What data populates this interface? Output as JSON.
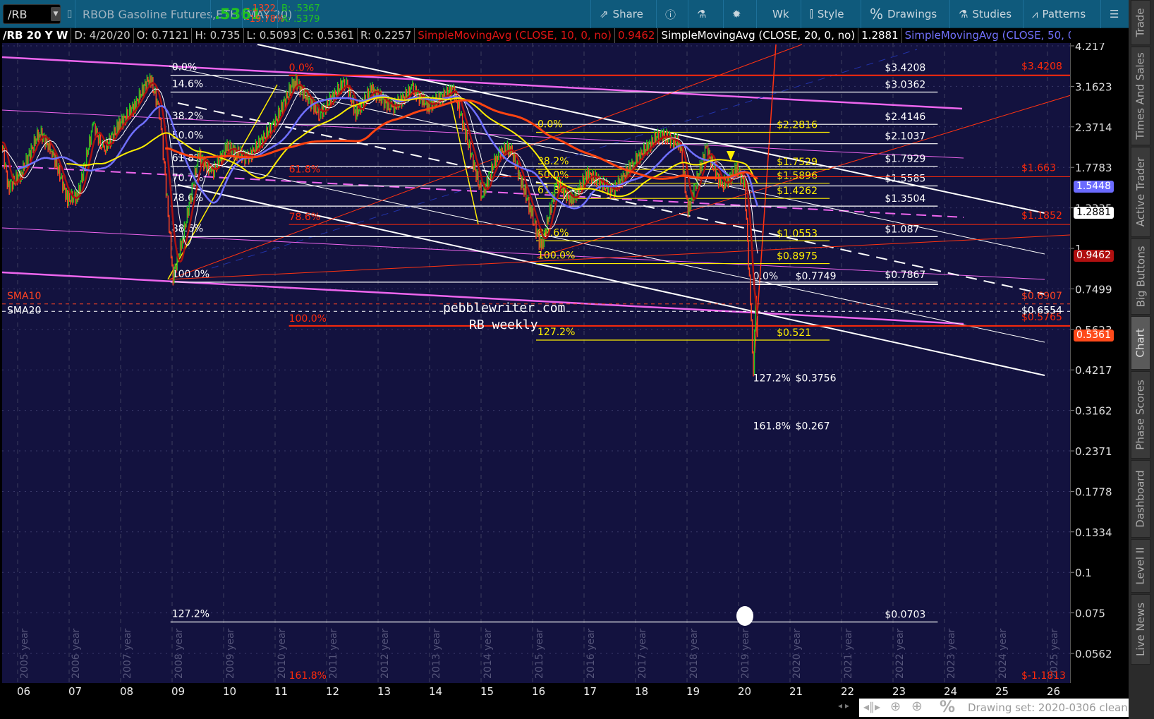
{
  "toolbar": {
    "symbol": "/RB",
    "description": "RBOB Gasoline Futures,ETH (MAY 20)",
    "last": ".5361",
    "change": "-.1322",
    "change_pct": "-19.78%",
    "bid": "B: .5367",
    "ask": "A: .5379",
    "buttons": {
      "share": "Share",
      "period": "Wk",
      "style": "Style",
      "drawings": "Drawings",
      "studies": "Studies",
      "patterns": "Patterns"
    },
    "colors": {
      "bg": "#0f5a7c",
      "up": "#22c322",
      "down": "#ff4422"
    }
  },
  "infobar": {
    "symbol": "/RB 20 Y W",
    "date": "D: 4/20/20",
    "open": "O: 0.7121",
    "high": "H: 0.735",
    "low": "L: 0.5093",
    "close": "C: 0.5361",
    "range": "R: 0.2257",
    "sma10_label": "SimpleMovingAvg (CLOSE, 10, 0, no)",
    "sma10_value": "0.9462",
    "sma20_label": "SimpleMovingAvg (CLOSE, 20, 0, no)",
    "sma20_value": "1.2881",
    "sma50_label": "SimpleMovingAvg (CLOSE, 50, 0,..."
  },
  "chart_data": {
    "type": "line",
    "scale": "log",
    "y_ticks": [
      "4.217",
      "3.1623",
      "2.3714",
      "1.7783",
      "1.3335",
      "1",
      "0.7499",
      "0.5623",
      "0.4217",
      "0.3162",
      "0.2371",
      "0.1778",
      "0.1334",
      "0.1",
      "0.075",
      "0.0562"
    ],
    "x_ticks": [
      "06",
      "07",
      "08",
      "09",
      "10",
      "11",
      "12",
      "13",
      "14",
      "15",
      "16",
      "17",
      "18",
      "19",
      "20",
      "21",
      "22",
      "23",
      "24",
      "25",
      "26"
    ],
    "year_grid": [
      "2005 year",
      "2006 year",
      "2007 year",
      "2008 year",
      "2009 year",
      "2010 year",
      "2011 year",
      "2012 year",
      "2013 year",
      "2014 year",
      "2015 year",
      "2016 year",
      "2017 year",
      "2018 year",
      "2019 year",
      "2020 year",
      "2021 year",
      "2022 year",
      "2023 year",
      "2024 year",
      "2025 year"
    ],
    "price": [
      [
        2005.0,
        1.45
      ],
      [
        2005.3,
        1.75
      ],
      [
        2005.6,
        2.25
      ],
      [
        2005.75,
        1.55
      ],
      [
        2006.0,
        1.7
      ],
      [
        2006.35,
        2.3
      ],
      [
        2006.6,
        2.0
      ],
      [
        2006.9,
        1.42
      ],
      [
        2007.1,
        1.45
      ],
      [
        2007.4,
        2.4
      ],
      [
        2007.6,
        2.0
      ],
      [
        2007.9,
        2.4
      ],
      [
        2008.2,
        2.75
      ],
      [
        2008.5,
        3.4
      ],
      [
        2008.7,
        2.6
      ],
      [
        2008.95,
        0.82
      ],
      [
        2009.15,
        1.1
      ],
      [
        2009.45,
        1.95
      ],
      [
        2009.7,
        1.7
      ],
      [
        2010.0,
        2.05
      ],
      [
        2010.4,
        1.9
      ],
      [
        2010.9,
        2.4
      ],
      [
        2011.3,
        3.3
      ],
      [
        2011.8,
        2.6
      ],
      [
        2012.3,
        3.3
      ],
      [
        2012.5,
        2.6
      ],
      [
        2012.8,
        3.1
      ],
      [
        2013.2,
        2.7
      ],
      [
        2013.6,
        3.1
      ],
      [
        2013.9,
        2.75
      ],
      [
        2014.4,
        3.1
      ],
      [
        2014.95,
        1.45
      ],
      [
        2015.25,
        1.95
      ],
      [
        2015.5,
        2.05
      ],
      [
        2015.9,
        1.3
      ],
      [
        2016.1,
        1.0
      ],
      [
        2016.4,
        1.6
      ],
      [
        2016.7,
        1.4
      ],
      [
        2017.0,
        1.7
      ],
      [
        2017.5,
        1.5
      ],
      [
        2017.9,
        1.85
      ],
      [
        2018.4,
        2.25
      ],
      [
        2018.8,
        2.1
      ],
      [
        2018.95,
        1.3
      ],
      [
        2019.3,
        2.05
      ],
      [
        2019.6,
        1.55
      ],
      [
        2019.9,
        1.75
      ],
      [
        2020.05,
        1.6
      ],
      [
        2020.18,
        0.6
      ],
      [
        2020.22,
        0.42
      ],
      [
        2020.26,
        0.75
      ],
      [
        2020.3,
        0.54
      ]
    ],
    "fib_white": {
      "from": 2008.9,
      "to": 2023.8,
      "levels": [
        {
          "pct": "0.0%",
          "price": 3.4208,
          "label": "$3.4208"
        },
        {
          "pct": "14.6%",
          "price": 3.0362,
          "label": "$3.0362"
        },
        {
          "pct": "38.2%",
          "price": 2.4146,
          "label": "$2.4146"
        },
        {
          "pct": "50.0%",
          "price": 2.1037,
          "label": "$2.1037"
        },
        {
          "pct": "61.8%",
          "price": 1.7929,
          "label": "$1.7929"
        },
        {
          "pct": "70.7%",
          "price": 1.5585,
          "label": "$1.5585"
        },
        {
          "pct": "78.6%",
          "price": 1.3504,
          "label": "$1.3504"
        },
        {
          "pct": "88.6%",
          "price": 1.087,
          "label": "$1.087"
        },
        {
          "pct": "100.0%",
          "price": 0.7867,
          "label": "$0.7867"
        },
        {
          "pct": "127.2%",
          "price": 0.0703,
          "label": "$0.0703"
        }
      ]
    },
    "fib_yellow": {
      "from": 2016.0,
      "to": 2021.7,
      "levels": [
        {
          "pct": "0.0%",
          "price": 2.2816,
          "label": "$2.2816"
        },
        {
          "pct": "38.2%",
          "price": 1.7529,
          "label": "$1.7529"
        },
        {
          "pct": "50.0%",
          "price": 1.5896,
          "label": "$1.5896"
        },
        {
          "pct": "61.8%",
          "price": 1.4262,
          "label": "$1.4262"
        },
        {
          "pct": "88.6%",
          "price": 1.0553,
          "label": "$1.0553"
        },
        {
          "pct": "100.0%",
          "price": 0.8975,
          "label": "$0.8975"
        },
        {
          "pct": "127.2%",
          "price": 0.521,
          "label": "$0.521"
        }
      ]
    },
    "fib_red": {
      "from": 2011.2,
      "levels": [
        {
          "pct": "0.0%",
          "price": 3.4208,
          "label": "$3.4208"
        },
        {
          "pct": "61.8%",
          "price": 1.663,
          "label": "$1.663"
        },
        {
          "pct": "78.6%",
          "price": 1.1852,
          "label": "$1.1852"
        },
        {
          "pct": "100.0%",
          "price": 0.5765,
          "label": "$0.5765"
        },
        {
          "pct": "161.8%",
          "price": null,
          "label": "$-1.1813"
        }
      ]
    },
    "fib_small": {
      "from": 2020.2,
      "levels": [
        {
          "pct": "0.0%",
          "price": 0.7749,
          "label": "$0.7749"
        },
        {
          "pct": "127.2%",
          "price": 0.3756,
          "label": "$0.3756"
        },
        {
          "pct": "161.8%",
          "price": 0.267,
          "label": "$0.267"
        }
      ]
    },
    "sma_lines": [
      {
        "name": "SMA10",
        "price": 0.6907,
        "label": "$0.6907",
        "color": "#ff4422"
      },
      {
        "name": "SMA20",
        "price": 0.6554,
        "label": "$0.6554",
        "color": "#ffffff"
      }
    ],
    "badges": [
      {
        "value": "1.5448",
        "price": 1.5448,
        "bg": "#6b6bff",
        "fg": "#fff"
      },
      {
        "value": "1.2881",
        "price": 1.2881,
        "bg": "#ffffff",
        "fg": "#000"
      },
      {
        "value": "0.9462",
        "price": 0.9462,
        "bg": "#b01010",
        "fg": "#fff"
      },
      {
        "value": "0.5361",
        "price": 0.5361,
        "bg": "#ff4a1a",
        "fg": "#fff"
      }
    ],
    "watermark": [
      "pebblewriter.com",
      "RB weekly"
    ]
  },
  "status": {
    "drawing_set": "Drawing set: 2020-0306 clean"
  },
  "sidebar": {
    "tabs": [
      "Trade",
      "Times And Sales",
      "Active Trader",
      "Big Buttons",
      "Chart",
      "Phase Scores",
      "Dashboard",
      "Level II",
      "Live News"
    ],
    "active": "Chart"
  }
}
